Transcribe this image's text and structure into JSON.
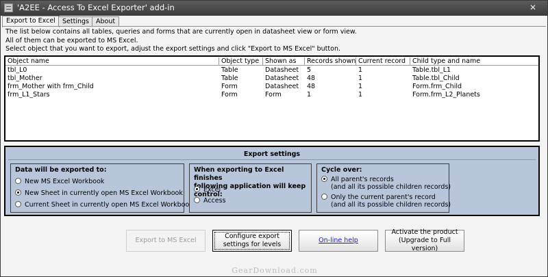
{
  "window": {
    "title": "'A2EE - Access To Excel Exporter' add-in",
    "close_glyph": "✕"
  },
  "tabs": [
    {
      "label": "Export to Excel",
      "active": true
    },
    {
      "label": "Settings",
      "active": false
    },
    {
      "label": "About",
      "active": false
    }
  ],
  "intro": [
    "The list below contains all tables, queries and forms that are currently open in datasheet view or form view.",
    "All of them can be exported to MS Excel.",
    "Select object that you want to export, adjust the export settings and click \"Export to MS Excel\" button."
  ],
  "grid": {
    "columns": [
      "Object name",
      "Object type",
      "Shown as",
      "Records shown",
      "Current record",
      "Child type and name"
    ],
    "rows": [
      [
        "tbl_L0",
        "Table",
        "Datasheet",
        "5",
        "1",
        "Table.tbl_L1"
      ],
      [
        "tbl_Mother",
        "Table",
        "Datasheet",
        "48",
        "1",
        "Table.tbl_Child"
      ],
      [
        "frm_Mother with frm_Child",
        "Form",
        "Datasheet",
        "48",
        "1",
        "Form.frm_Child"
      ],
      [
        "frm_L1_Stars",
        "Form",
        "Form",
        "1",
        "1",
        "Form.frm_L2_Planets"
      ]
    ]
  },
  "settings": {
    "title": "Export settings",
    "export_to": {
      "title": "Data will be exported to:",
      "options": [
        {
          "label": "New MS Excel Workbook",
          "checked": false
        },
        {
          "label": "New Sheet in currently open MS Excel Workbook",
          "checked": true
        },
        {
          "label": "Current Sheet in currently open MS Excel Workbook",
          "checked": false
        }
      ]
    },
    "control": {
      "title_line1": "When exporting to Excel finishes",
      "title_line2": "following application will keep control:",
      "options": [
        {
          "label": "Excel",
          "checked": true
        },
        {
          "label": "Access",
          "checked": false
        }
      ]
    },
    "cycle": {
      "title": "Cycle over:",
      "options": [
        {
          "label": "All parent's records",
          "sub": "(and all its possible children records)",
          "checked": true
        },
        {
          "label": "Only the current parent's record",
          "sub": "(and all its possible children records)",
          "checked": false
        }
      ]
    }
  },
  "buttons": {
    "export": "Export to MS Excel",
    "configure_line1": "Configure export",
    "configure_line2": "settings for levels",
    "help": "On-line help",
    "activate_line1": "Activate the product",
    "activate_line2": "(Upgrade to Full version)"
  },
  "watermark": "GearDownload.com"
}
